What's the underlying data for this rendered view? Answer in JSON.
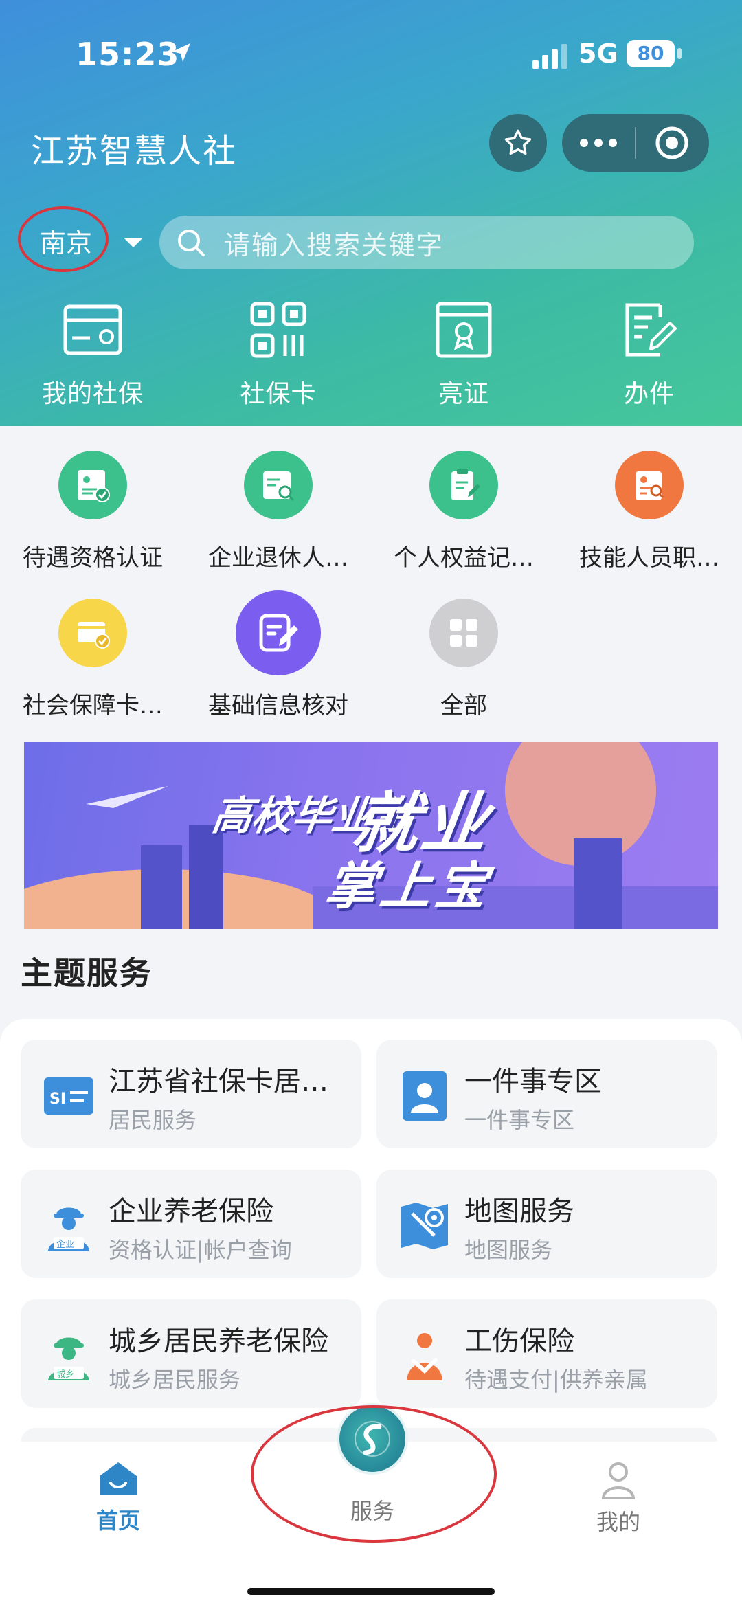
{
  "status_bar": {
    "time": "15:23",
    "network": "5G",
    "battery": "80"
  },
  "header": {
    "title": "江苏智慧人社"
  },
  "location": {
    "city": "南京"
  },
  "search": {
    "placeholder": "请输入搜索关键字"
  },
  "quick_actions": [
    {
      "label": "我的社保",
      "icon": "wallet-card-icon"
    },
    {
      "label": "社保卡",
      "icon": "qr-code-icon"
    },
    {
      "label": "亮证",
      "icon": "certificate-icon"
    },
    {
      "label": "办件",
      "icon": "document-edit-icon"
    }
  ],
  "services": [
    {
      "label": "待遇资格认证",
      "color": "#3cc08c"
    },
    {
      "label": "企业退休人…",
      "color": "#3cc08c"
    },
    {
      "label": "个人权益记…",
      "color": "#3cc08c"
    },
    {
      "label": "技能人员职…",
      "color": "#f07840"
    },
    {
      "label": "社会保障卡…",
      "color": "#f8d64a"
    },
    {
      "label": "基础信息核对",
      "color": "#7b5ef0"
    },
    {
      "label": "全部",
      "color": "#cfcfd2"
    }
  ],
  "banner": {
    "line1": "高校毕业生",
    "line2": "就业",
    "line3": "掌上宝"
  },
  "theme_section": {
    "title": "主题服务"
  },
  "theme_cards": [
    {
      "title": "江苏省社保卡居…",
      "subtitle": "居民服务",
      "icon": "social-card-icon"
    },
    {
      "title": "一件事专区",
      "subtitle": "一件事专区",
      "icon": "person-book-icon"
    },
    {
      "title": "企业养老保险",
      "subtitle": "资格认证|帐户查询",
      "icon": "enterprise-worker-icon",
      "badge": "企业"
    },
    {
      "title": "地图服务",
      "subtitle": "地图服务",
      "icon": "map-pin-icon"
    },
    {
      "title": "城乡居民养老保险",
      "subtitle": "城乡居民服务",
      "icon": "resident-worker-icon",
      "badge": "城乡"
    },
    {
      "title": "工伤保险",
      "subtitle": "待遇支付|供养亲属",
      "icon": "injury-icon"
    }
  ],
  "tab_bar": [
    {
      "label": "首页",
      "active_color": "#2f86c7"
    },
    {
      "label": "服务"
    },
    {
      "label": "我的"
    }
  ],
  "colors": {
    "accent": "#2f86c7",
    "annotation_red": "#d9363e"
  }
}
